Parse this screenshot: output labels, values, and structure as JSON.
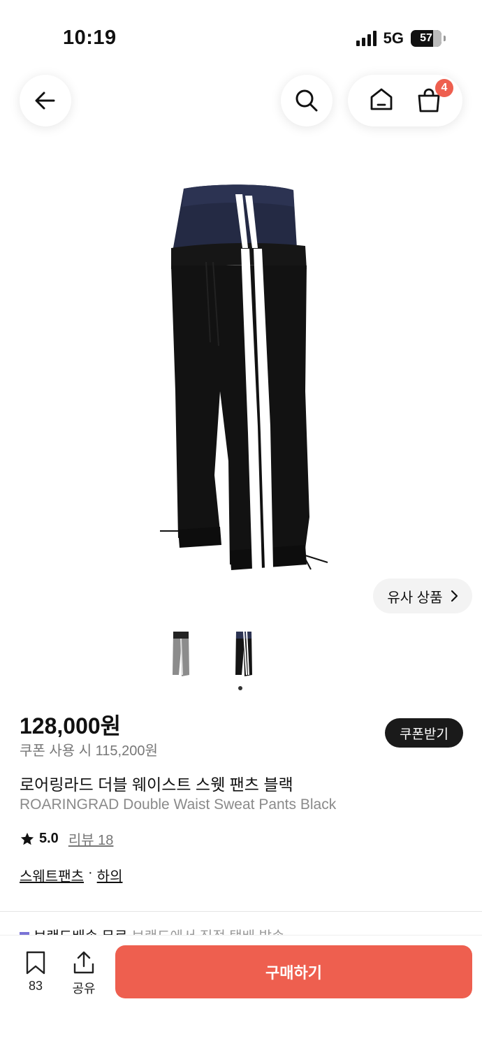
{
  "status_bar": {
    "time": "10:19",
    "network": "5G",
    "battery": "57"
  },
  "nav": {
    "cart_count": "4"
  },
  "product": {
    "similar_label": "유사 상품",
    "price": "128,000원",
    "coupon_price": "쿠폰 사용 시 115,200원",
    "coupon_button": "쿠폰받기",
    "name_ko": "로어링라드 더블 웨이스트 스웻 팬츠 블랙",
    "name_en": "ROARINGRAD Double Waist Sweat Pants Black",
    "rating": "5.0",
    "review_label": "리뷰 18",
    "categories": [
      "스웨트팬츠",
      "하의"
    ],
    "category_separator": "·"
  },
  "brand": {
    "title": "브랜드배송 무료",
    "sub": "브랜드에서 직접 택배 발송"
  },
  "bottom": {
    "save_count": "83",
    "share_label": "공유",
    "buy_label": "구매하기"
  },
  "colors": {
    "accent": "#ee5f4f",
    "dark": "#1a1a1a"
  }
}
